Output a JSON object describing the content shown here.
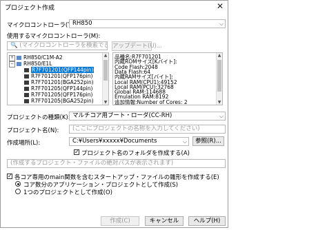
{
  "window": {
    "title": "プロジェクト作成",
    "close_glyph": "✕"
  },
  "microcontroller": {
    "label": "マイクロコントローラ(T):",
    "value": "RH850"
  },
  "use_mcu": {
    "label": "使用するマイクロコントローラ(M):",
    "search_placeholder": "(マイクロコントローラを検索できます)",
    "update_button": "アップデート(U)..."
  },
  "tree": [
    {
      "expander": "+",
      "label": "RH850/C1M-A2",
      "selected": false
    },
    {
      "expander": "−",
      "label": "RH850/E1L",
      "selected": false
    },
    {
      "label": "R7F701201(QFP144pin)",
      "selected": true
    },
    {
      "label": "R7F701201(QFP176pin)",
      "selected": false
    },
    {
      "label": "R7F701201(BGA252pin)",
      "selected": false
    },
    {
      "label": "R7F701205(QFP144pin)",
      "selected": false
    },
    {
      "label": "R7F701205(QFP176pin)",
      "selected": false
    },
    {
      "label": "R7F701205(BGA252pin)",
      "selected": false
    }
  ],
  "device_info": [
    "品種名:R7F701201",
    "内蔵ROMサイズ[Kバイト]:",
    "  Code Flash:2048",
    "  Data Flash:64",
    "内蔵RAMサイズ[バイト]:",
    "  Local RAM(CPU1):49152",
    "  Local RAM(PCU):32768",
    "  Global RAM:114688",
    "  Emulation RAM:8192",
    "追加情報:Number of Cores: 2"
  ],
  "project_type": {
    "label": "プロジェクトの種類(K):",
    "value": "マルチコア用ブート・ローダ(CC-RH)"
  },
  "project_name": {
    "label": "プロジェクト名(N):",
    "placeholder": "(ここにプロジェクトの名称を入力してください)"
  },
  "location": {
    "label": "作成場所(L):",
    "value": "C:¥Users¥xxxxx¥Documents",
    "browse_button": "参照(R)..."
  },
  "make_folder": {
    "label": "プロジェクト名のフォルダを作成する(A)",
    "checked": true
  },
  "path_preview": "(作成するプロジェクト・ファイルの絶対パスが表示されます)",
  "copy_startup": {
    "label": "各コア専用のmain関数を含むスタートアップ・ファイルの雛形を作成する(E)",
    "checked": true
  },
  "radio_apps": {
    "label": "コア数分のアプリケーション・プロジェクトとして作成(S)",
    "checked": true
  },
  "radio_one": {
    "label": "1つのプロジェクトとして作成(O)",
    "checked": false
  },
  "buttons": {
    "create": "作成(C)",
    "cancel": "キャンセル",
    "help": "ヘルプ(H)"
  }
}
